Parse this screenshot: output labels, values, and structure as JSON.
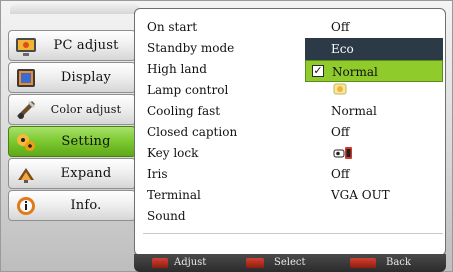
{
  "left_menu": {
    "items": [
      {
        "label": "PC adjust",
        "icon": "pc-adjust-icon"
      },
      {
        "label": "Display",
        "icon": "display-icon"
      },
      {
        "label": "Color adjust",
        "icon": "color-adjust-icon"
      },
      {
        "label": "Setting",
        "icon": "setting-icon",
        "selected": true
      },
      {
        "label": "Expand",
        "icon": "expand-icon"
      },
      {
        "label": "Info.",
        "icon": "info-icon"
      }
    ]
  },
  "settings": {
    "rows": [
      {
        "label": "On start",
        "value": "Off"
      },
      {
        "label": "Standby mode",
        "value": ""
      },
      {
        "label": "High land",
        "value": ""
      },
      {
        "label": "Lamp control",
        "value": "lamp-icon"
      },
      {
        "label": "Cooling fast",
        "value": "Normal"
      },
      {
        "label": "Closed caption",
        "value": "Off"
      },
      {
        "label": "Key lock",
        "value": "key-lock-icon"
      },
      {
        "label": "Iris",
        "value": "Off"
      },
      {
        "label": "Terminal",
        "value": "VGA OUT"
      },
      {
        "label": "Sound",
        "value": ""
      }
    ],
    "standby_options": [
      {
        "label": "Eco",
        "highlight": "dark"
      },
      {
        "label": "Normal",
        "highlight": "green",
        "checked": true
      }
    ]
  },
  "footer": {
    "adjust": "Adjust",
    "select": "Select",
    "back": "Back"
  },
  "colors": {
    "selected_green": "#7bc82f",
    "eco_dark": "#2b3a46",
    "panel_border": "#6f6f6f"
  }
}
